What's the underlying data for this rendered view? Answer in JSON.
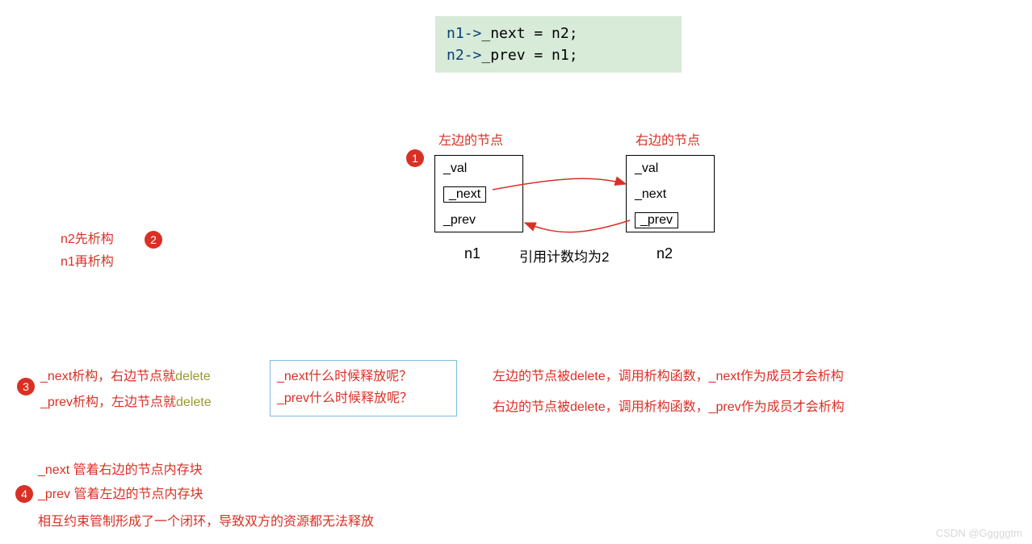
{
  "code": {
    "line1_a": "n1->",
    "line1_b": "_next = n2;",
    "line2_a": "n2->",
    "line2_b": "_prev = n1;"
  },
  "badges": {
    "b1": "1",
    "b2": "2",
    "b3": "3",
    "b4": "4"
  },
  "leftTitle": "左边的节点",
  "rightTitle": "右边的节点",
  "node": {
    "val": "_val",
    "next": "_next",
    "prev": "_prev"
  },
  "n1": "n1",
  "n2": "n2",
  "refCount": "引用计数均为2",
  "destructOrder": {
    "a": "n2先析构",
    "b": "n1再析构"
  },
  "row3left": {
    "a_pre": "_next析构，右边节点就",
    "a_del": "delete",
    "b_pre": "_prev析构，左边节点就",
    "b_del": "delete"
  },
  "question": {
    "a": "_next什么时候释放呢？",
    "b": "_prev什么时候释放呢？"
  },
  "row3right": {
    "a": "左边的节点被delete，调用析构函数，_next作为成员才会析构",
    "b": "右边的节点被delete，调用析构函数，_prev作为成员才会析构"
  },
  "row4": {
    "a": "_next 管着右边的节点内存块",
    "b": "_prev 管着左边的节点内存块",
    "c": "相互约束管制形成了一个闭环，导致双方的资源都无法释放"
  },
  "watermark": "CSDN @Gggggtm"
}
